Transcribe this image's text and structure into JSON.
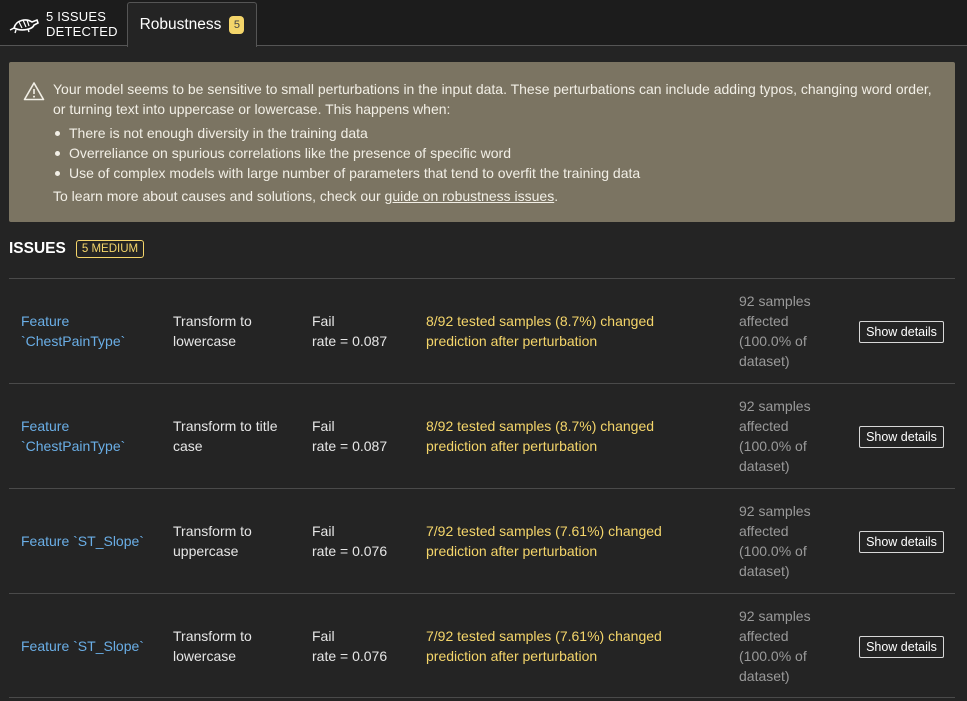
{
  "header": {
    "issues_count_line1": "5 ISSUES",
    "issues_count_line2": "DETECTED",
    "tab": {
      "label": "Robustness",
      "badge": "5"
    }
  },
  "banner": {
    "intro": "Your model seems to be sensitive to small perturbations in the input data. These perturbations can include adding typos, changing word order, or turning text into uppercase or lowercase. This happens when:",
    "bullets": [
      "There is not enough diversity in the training data",
      "Overreliance on spurious correlations like the presence of specific word",
      "Use of complex models with large number of parameters that tend to overfit the training data"
    ],
    "outro_prefix": "To learn more about causes and solutions, check our ",
    "link_text": "guide on robustness issues",
    "outro_suffix": "."
  },
  "issues": {
    "heading": "ISSUES",
    "severity_badge": "5 MEDIUM",
    "rows": [
      {
        "feature": [
          "Feature",
          "`ChestPainType`"
        ],
        "transform": [
          "Transform to",
          "lowercase"
        ],
        "rate": [
          "Fail",
          "rate = 0.087"
        ],
        "description": [
          "8/92 tested samples (8.7%) changed",
          "prediction after perturbation"
        ],
        "affected": [
          "92 samples",
          "affected",
          "(100.0% of",
          "dataset)"
        ],
        "button": "Show details"
      },
      {
        "feature": [
          "Feature",
          "`ChestPainType`"
        ],
        "transform": [
          "Transform to title",
          "case"
        ],
        "rate": [
          "Fail",
          "rate = 0.087"
        ],
        "description": [
          "8/92 tested samples (8.7%) changed",
          "prediction after perturbation"
        ],
        "affected": [
          "92 samples",
          "affected",
          "(100.0% of",
          "dataset)"
        ],
        "button": "Show details"
      },
      {
        "feature": [
          "Feature `ST_Slope`"
        ],
        "transform": [
          "Transform to",
          "uppercase"
        ],
        "rate": [
          "Fail",
          "rate = 0.076"
        ],
        "description": [
          "7/92 tested samples (7.61%) changed",
          "prediction after perturbation"
        ],
        "affected": [
          "92 samples",
          "affected",
          "(100.0% of",
          "dataset)"
        ],
        "button": "Show details"
      },
      {
        "feature": [
          "Feature `ST_Slope`"
        ],
        "transform": [
          "Transform to",
          "lowercase"
        ],
        "rate": [
          "Fail",
          "rate = 0.076"
        ],
        "description": [
          "7/92 tested samples (7.61%) changed",
          "prediction after perturbation"
        ],
        "affected": [
          "92 samples",
          "affected",
          "(100.0% of",
          "dataset)"
        ],
        "button": "Show details"
      }
    ]
  },
  "colors": {
    "accent_yellow": "#f4d56a",
    "link_blue": "#6aaee6",
    "banner_bg": "#7b7462",
    "page_bg": "#242424"
  }
}
